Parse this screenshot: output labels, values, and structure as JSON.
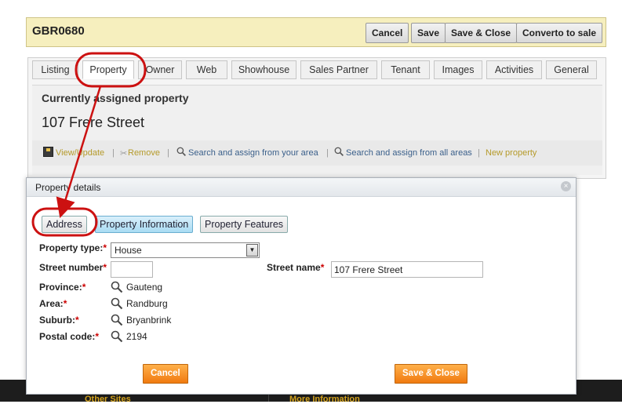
{
  "header": {
    "code": "GBR0680",
    "buttons": {
      "cancel": "Cancel",
      "save": "Save",
      "save_close": "Save & Close",
      "convert": "Converto to sale"
    }
  },
  "tabs": [
    "Listing",
    "Property",
    "Owner",
    "Web",
    "Showhouse",
    "Sales Partner",
    "Tenant",
    "Images",
    "Activities",
    "General"
  ],
  "active_tab": "Property",
  "assigned": {
    "title": "Currently assigned property",
    "street": "107 Frere Street",
    "actions": {
      "view_update": "View/Update",
      "remove": "Remove",
      "search_area": "Search and assign from your area",
      "search_all": "Search and assign from all areas",
      "new_property": "New property"
    }
  },
  "footer": {
    "left": "Other Sites",
    "right": "More Information"
  },
  "dialog": {
    "title": "Property details",
    "subtabs": {
      "address": "Address",
      "info": "Property Information",
      "features": "Property Features"
    },
    "fields": {
      "property_type_label": "Property type:",
      "property_type_value": "House",
      "street_number_label": "Street number",
      "street_number_value": "",
      "street_name_label": "Street name",
      "street_name_value": "107 Frere Street",
      "province_label": "Province:",
      "province_value": "Gauteng",
      "area_label": "Area:",
      "area_value": "Randburg",
      "suburb_label": "Suburb:",
      "suburb_value": "Bryanbrink",
      "postal_label": "Postal code:",
      "postal_value": "2194"
    },
    "required_mark": "*",
    "buttons": {
      "cancel": "Cancel",
      "save_close": "Save & Close"
    }
  },
  "colors": {
    "annotation": "#cc1111",
    "header_bg": "#f6efbe",
    "orange": "#f07a10"
  }
}
